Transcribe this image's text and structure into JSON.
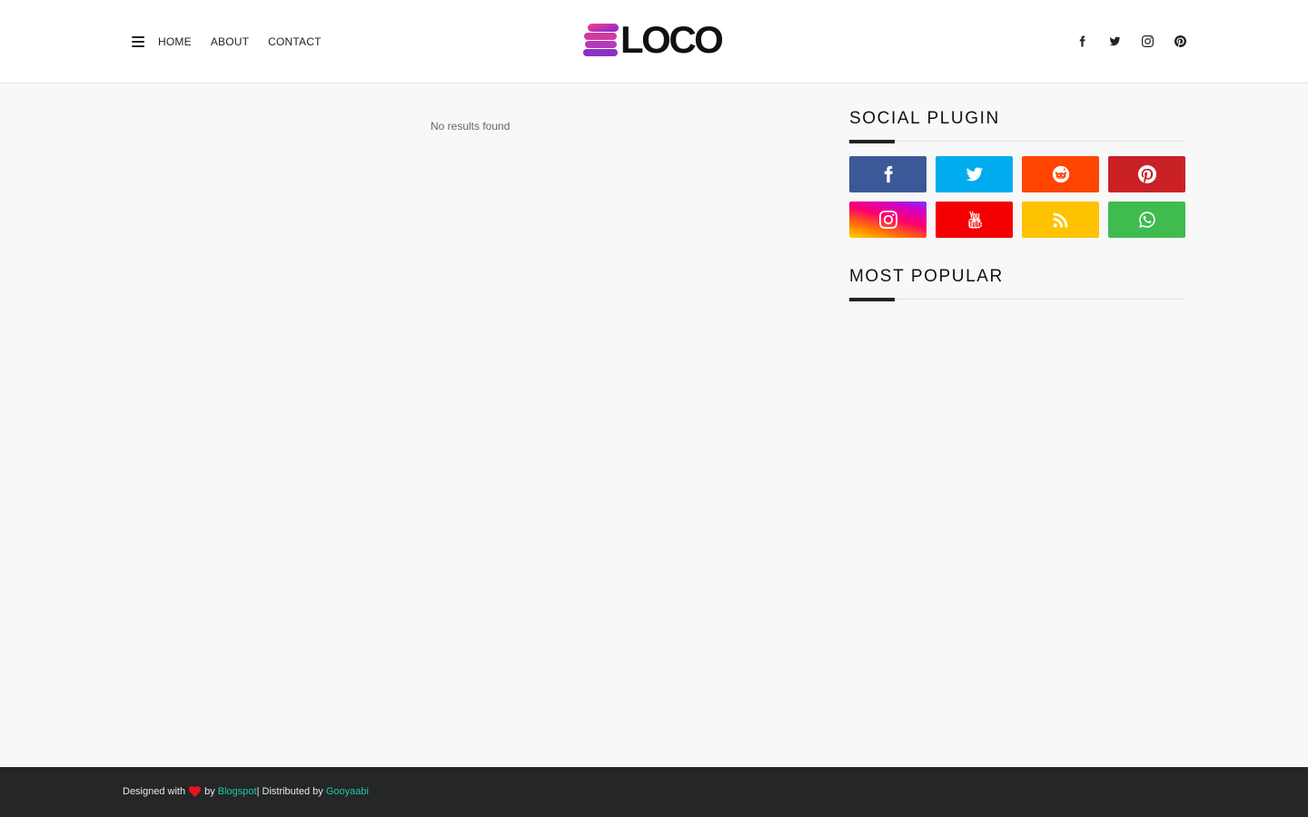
{
  "header": {
    "nav": [
      "Home",
      "About",
      "Contact"
    ],
    "logo_text": "LOCO",
    "social_icons": [
      "facebook-icon",
      "twitter-icon",
      "instagram-icon",
      "pinterest-icon"
    ]
  },
  "main": {
    "no_results": "No results found"
  },
  "sidebar": {
    "social_title": "Social Plugin",
    "social_buttons": [
      {
        "name": "facebook",
        "color": "#3b5998"
      },
      {
        "name": "twitter",
        "color": "#00acee"
      },
      {
        "name": "reddit",
        "color": "#ff4500"
      },
      {
        "name": "pinterest",
        "color": "#ca2127"
      },
      {
        "name": "instagram",
        "color": "gradient"
      },
      {
        "name": "youtube",
        "color": "#f50000"
      },
      {
        "name": "rss",
        "color": "#ffc200"
      },
      {
        "name": "whatsapp",
        "color": "#3fbb50"
      }
    ],
    "popular_title": "Most Popular"
  },
  "footer": {
    "designed_with": "Designed with",
    "by": "by",
    "blogspot": "Blogspot",
    "distributed_by": "| Distributed by",
    "gooyaabi": "Gooyaabi",
    "accent": "#1fc6a4"
  }
}
